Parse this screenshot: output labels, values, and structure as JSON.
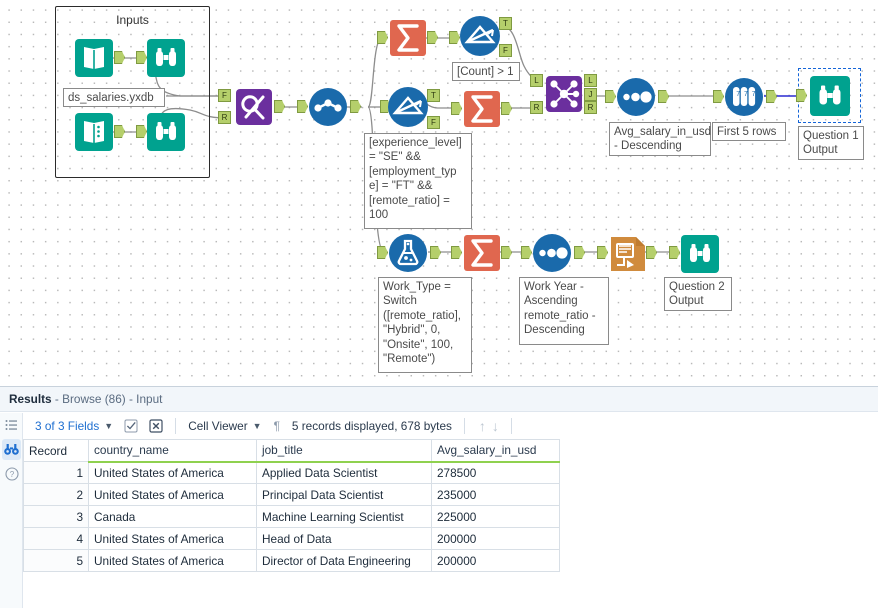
{
  "canvas": {
    "container": {
      "title": "Inputs"
    },
    "tools": [
      {
        "id": "input-top",
        "name": "input-data-tool",
        "icon": "book-icon",
        "kind": "input"
      },
      {
        "id": "input-bottom",
        "name": "input-data-tool",
        "icon": "book-list-icon",
        "kind": "input"
      },
      {
        "id": "browse-top",
        "name": "browse-tool",
        "icon": "binoculars-icon",
        "kind": "browse"
      },
      {
        "id": "browse-bottom",
        "name": "browse-tool",
        "icon": "binoculars-icon",
        "kind": "browse"
      },
      {
        "id": "findreplace",
        "name": "find-replace-tool",
        "icon": "find-replace-icon",
        "kind": "join"
      },
      {
        "id": "cleanse",
        "name": "data-cleansing-tool",
        "icon": "data-cleansing-icon",
        "kind": "prep"
      },
      {
        "id": "summarize-1",
        "name": "summarize-tool",
        "icon": "sigma-icon",
        "kind": "transform"
      },
      {
        "id": "filter-1",
        "name": "filter-tool",
        "icon": "filter-icon",
        "kind": "prep"
      },
      {
        "id": "filter-2",
        "name": "filter-tool",
        "icon": "filter-icon",
        "kind": "prep"
      },
      {
        "id": "summarize-2",
        "name": "summarize-tool",
        "icon": "sigma-icon",
        "kind": "transform"
      },
      {
        "id": "join",
        "name": "join-tool",
        "icon": "join-icon",
        "kind": "join"
      },
      {
        "id": "sort-1",
        "name": "sort-tool",
        "icon": "sort-icon",
        "kind": "prep"
      },
      {
        "id": "sample",
        "name": "sample-tool",
        "icon": "sample-icon",
        "kind": "prep"
      },
      {
        "id": "browse-q1",
        "name": "browse-tool",
        "icon": "binoculars-icon",
        "kind": "browse",
        "selected": true
      },
      {
        "id": "formula",
        "name": "formula-tool",
        "icon": "flask-icon",
        "kind": "prep"
      },
      {
        "id": "summarize-3",
        "name": "summarize-tool",
        "icon": "sigma-icon",
        "kind": "transform"
      },
      {
        "id": "sort-2",
        "name": "sort-tool",
        "icon": "sort-icon",
        "kind": "prep"
      },
      {
        "id": "output",
        "name": "output-data-tool",
        "icon": "output-icon",
        "kind": "output"
      },
      {
        "id": "browse-q2",
        "name": "browse-tool",
        "icon": "binoculars-icon",
        "kind": "browse"
      }
    ],
    "annotations": {
      "file_label": "ds_salaries.yxdb",
      "count_filter": "[Count] > 1",
      "experience_filter": "[experience_level]\n= \"SE\" &&\n[employment_typ\ne] = \"FT\" &&\n[remote_ratio] =\n100",
      "sort_salary": "Avg_salary_in_usd\n- Descending",
      "sample_rows": "First 5 rows",
      "question1_output": "Question 1\nOutput",
      "work_type_formula": "Work_Type =\nSwitch\n([remote_ratio],\n\"Hybrid\", 0,\n\"Onsite\", 100,\n\"Remote\")",
      "sort_workyear": "Work Year -\nAscending\nremote_ratio -\nDescending",
      "question2_output": "Question 2\nOutput"
    },
    "anchor_labels": {
      "find_f": "F",
      "find_r": "R",
      "filter_t": "T",
      "filter_f": "F",
      "join_l_in": "L",
      "join_r_in": "R",
      "join_l_out": "L",
      "join_j_out": "J",
      "join_r_out": "R"
    }
  },
  "results": {
    "title_bold": "Results",
    "title_rest": " - Browse (86) - Input",
    "toolbar": {
      "fields_label": "3 of 3 Fields",
      "checkbox_icon": "checkbox-icon",
      "clear_icon": "clear-selection-icon",
      "viewer_label": "Cell Viewer",
      "pilcrow": "¶",
      "status": "5 records displayed, 678 bytes",
      "up_arrow": "↑",
      "down_arrow": "↓"
    },
    "rail": {
      "list_icon": "list-icon",
      "browse_icon": "binoculars-icon",
      "help_icon": "help-icon"
    },
    "table": {
      "columns": [
        "Record",
        "country_name",
        "job_title",
        "Avg_salary_in_usd"
      ],
      "rows": [
        {
          "record": "1",
          "country_name": "United States of America",
          "job_title": "Applied Data Scientist",
          "avg_salary_in_usd": "278500"
        },
        {
          "record": "2",
          "country_name": "United States of America",
          "job_title": "Principal Data Scientist",
          "avg_salary_in_usd": "235000"
        },
        {
          "record": "3",
          "country_name": "Canada",
          "job_title": "Machine Learning Scientist",
          "avg_salary_in_usd": "225000"
        },
        {
          "record": "4",
          "country_name": "United States of America",
          "job_title": "Head of Data",
          "avg_salary_in_usd": "200000"
        },
        {
          "record": "5",
          "country_name": "United States of America",
          "job_title": "Director of Data Engineering",
          "avg_salary_in_usd": "200000"
        }
      ]
    }
  },
  "colors": {
    "teal": "#00a28f",
    "blue": "#1a6aab",
    "orange": "#e0674f",
    "purple": "#6b2f9e",
    "tan": "#d08b3d",
    "anchor_green": "#b5cf6b",
    "accent_green": "#8fd14f",
    "select_blue": "#1565d8"
  }
}
